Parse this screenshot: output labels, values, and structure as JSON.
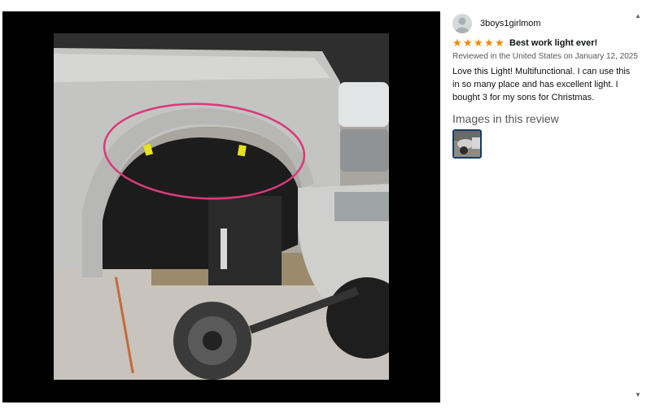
{
  "reviewer": {
    "name": "3boys1girlmom"
  },
  "review": {
    "rating": 5,
    "rating_max": 5,
    "title": "Best work light ever!",
    "date_line": "Reviewed in the United States on January 12, 2025",
    "body": "Love this Light! Multifunctional. I can use this in so many place and has excellent light. I bought 3 for my sons for Christmas."
  },
  "images_section": {
    "heading": "Images in this review"
  },
  "icons": {
    "avatar": "user-avatar-icon",
    "star": "star-icon",
    "scroll_up": "scroll-up-arrow-icon",
    "scroll_down": "scroll-down-arrow-icon"
  },
  "colors": {
    "star": "#f08804",
    "viewer_background": "#000000",
    "thumb_border": "#1a3a6a",
    "text": "#0f1111",
    "muted_text": "#565959"
  }
}
